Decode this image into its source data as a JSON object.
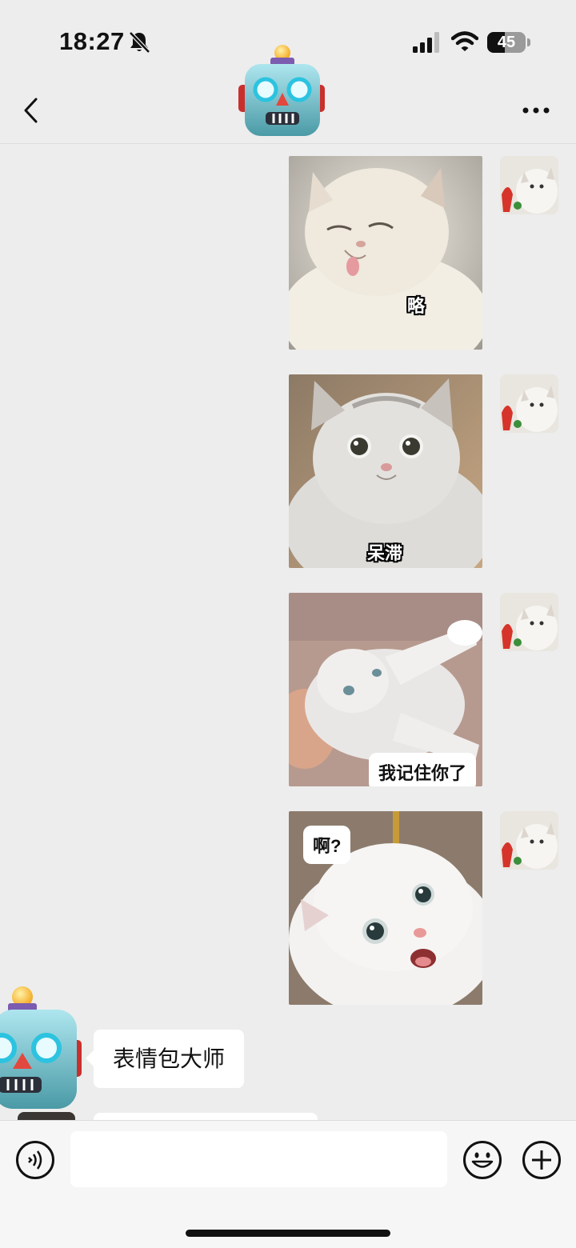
{
  "status_bar": {
    "time": "18:27",
    "battery": "45",
    "icons": [
      "bell-muted-icon",
      "signal-icon",
      "wifi-icon",
      "battery-icon"
    ]
  },
  "nav": {
    "chat_avatar": "robot-emoji",
    "icons": [
      "back-icon",
      "more-icon"
    ]
  },
  "messages": [
    {
      "sender": "me",
      "type": "sticker",
      "caption": "略",
      "caption_style": "outlined",
      "subject": "white persian cat sticking tongue out"
    },
    {
      "sender": "me",
      "type": "sticker",
      "caption": "呆滞",
      "caption_style": "outlined",
      "subject": "grey persian cat staring blankly"
    },
    {
      "sender": "me",
      "type": "sticker",
      "caption": "我记住你了",
      "caption_style": "boxed",
      "subject": "fluffy cat held up with arm stretched"
    },
    {
      "sender": "me",
      "type": "sticker",
      "caption": "啊?",
      "caption_style": "boxed",
      "subject": "surprised white cat with open mouth"
    },
    {
      "sender": "bot",
      "type": "text",
      "text": "表情包大师"
    }
  ],
  "input_bar": {
    "placeholder": "",
    "value": "",
    "icons": [
      "voice-icon",
      "emoji-icon",
      "plus-icon"
    ]
  },
  "colors": {
    "background": "#ededed",
    "bubble": "#ffffff",
    "input_bar": "#f6f6f6"
  }
}
